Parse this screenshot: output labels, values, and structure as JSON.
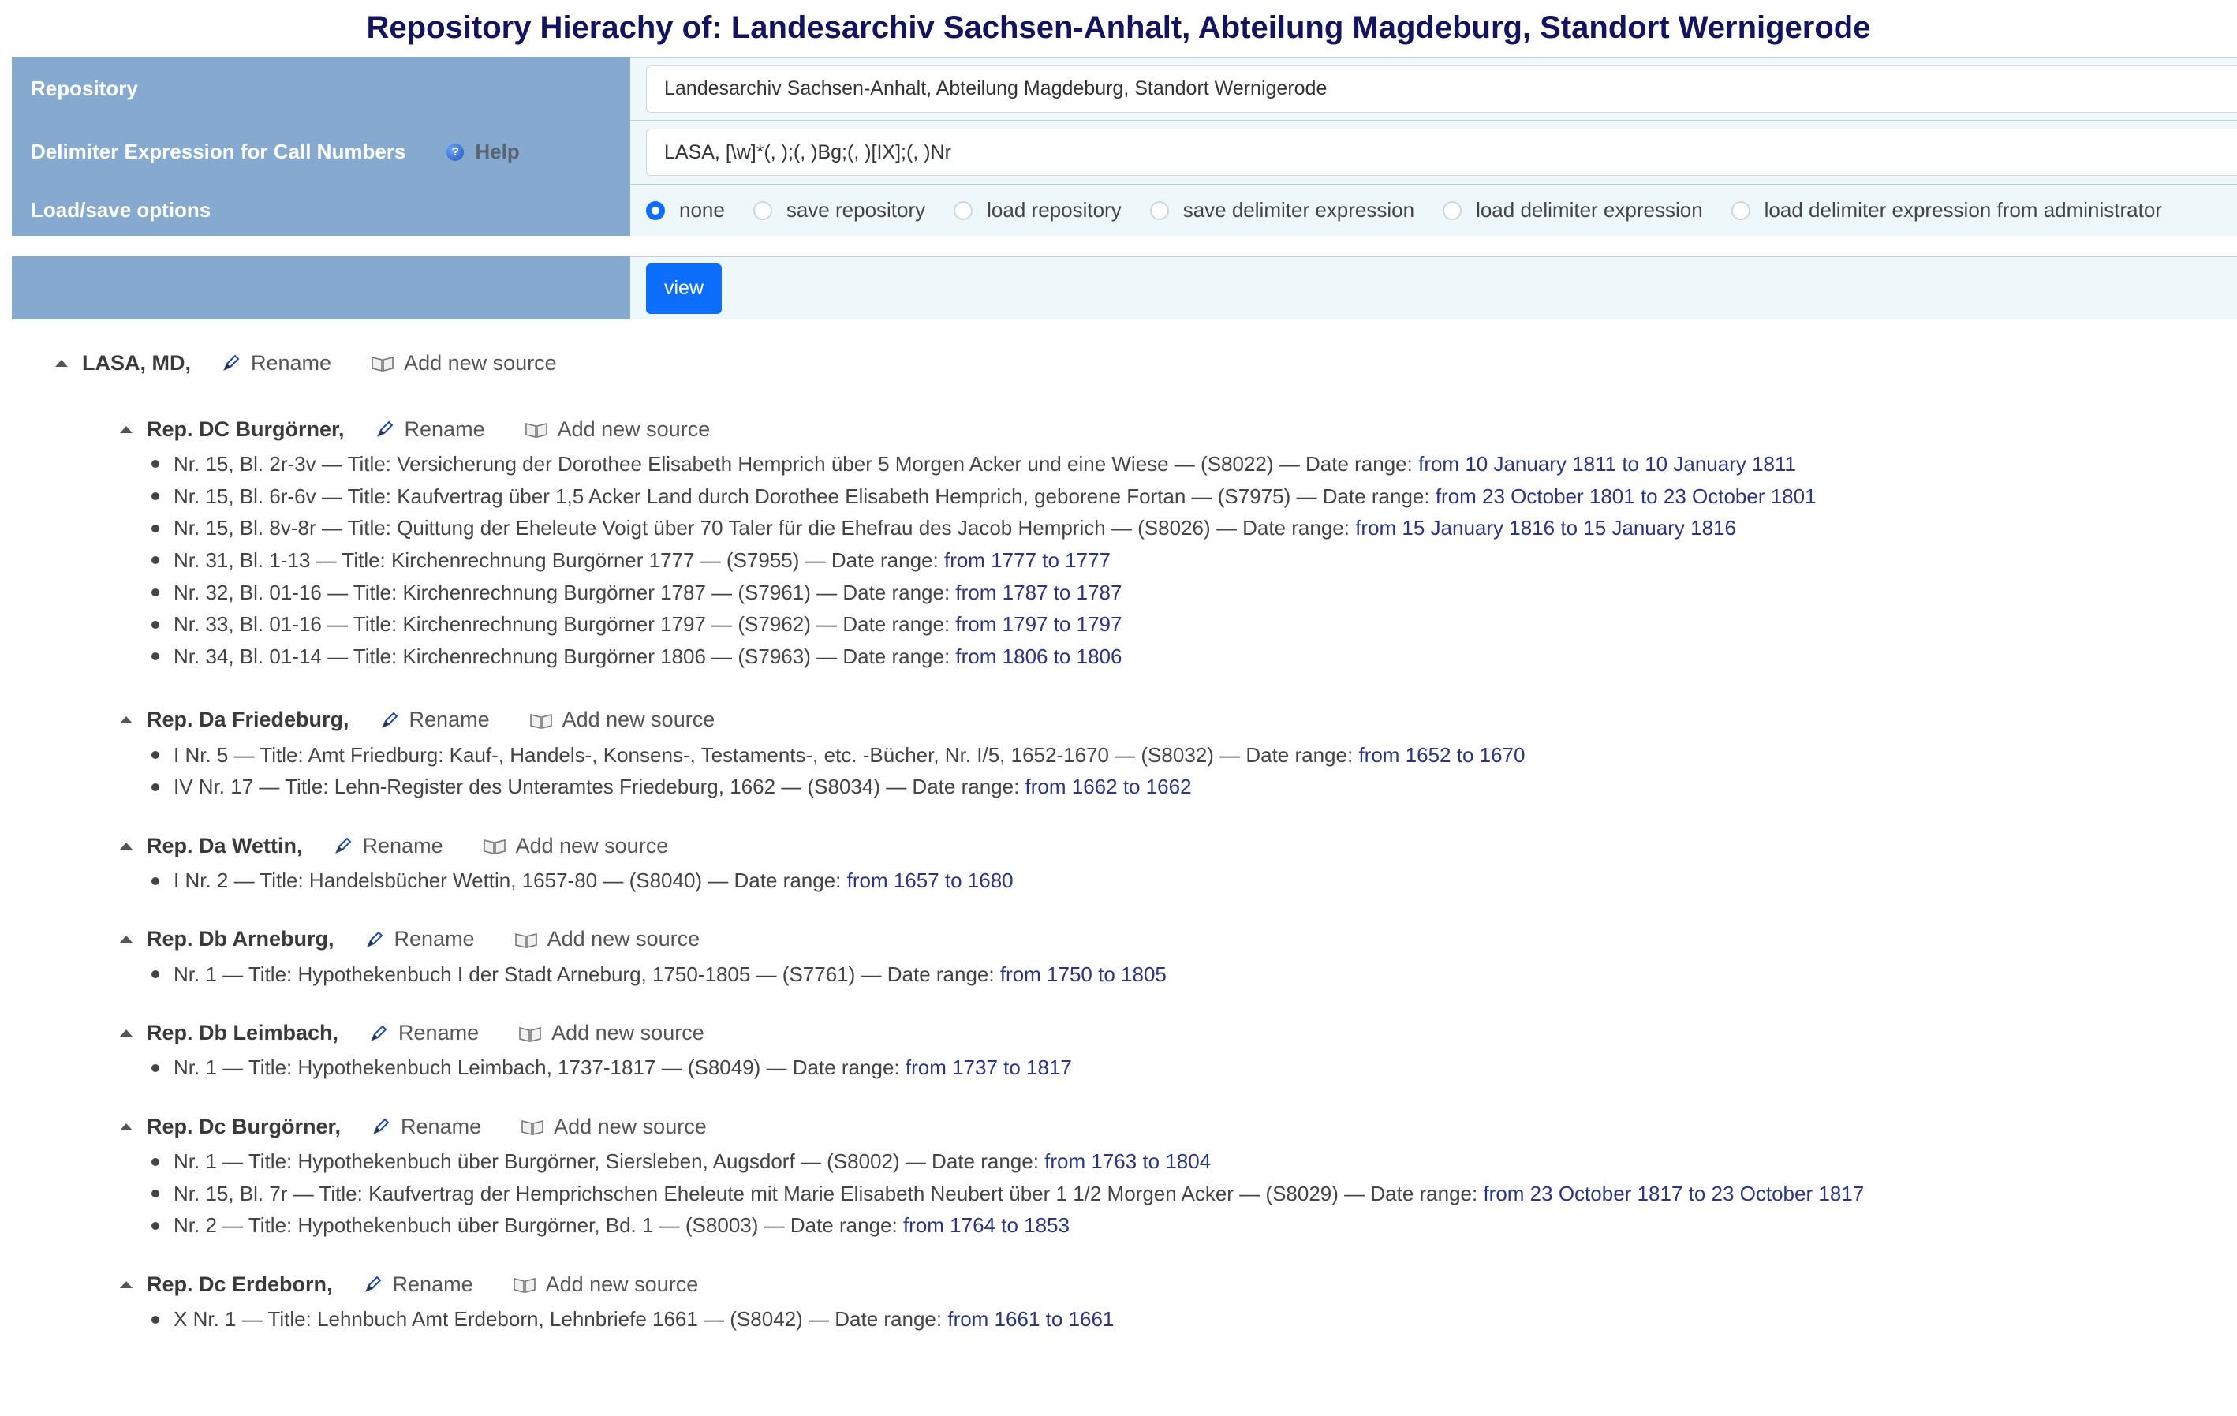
{
  "title": "Repository Hierachy of: Landesarchiv Sachsen-Anhalt, Abteilung Magdeburg, Standort Wernigerode",
  "form": {
    "repository_label": "Repository",
    "repository_value": "Landesarchiv Sachsen-Anhalt, Abteilung Magdeburg, Standort Wernigerode",
    "delimiter_label": "Delimiter Expression for Call Numbers",
    "help_label": "Help",
    "delimiter_value": "LASA, [\\w]*(, );(, )Bg;(, )[IX];(, )Nr",
    "options_label": "Load/save options",
    "options": [
      "none",
      "save repository",
      "load repository",
      "save delimiter expression",
      "load delimiter expression",
      "load delimiter expression from administrator"
    ],
    "selected_option": "none",
    "view_button": "view"
  },
  "actions": {
    "rename": "Rename",
    "add_source": "Add new source"
  },
  "root": {
    "name": "LASA, MD,"
  },
  "groups": [
    {
      "name": "Rep. DC Burgörner,",
      "items": [
        {
          "text": "Nr. 15, Bl. 2r-3v — Title: Versicherung der Dorothee Elisabeth Hemprich über 5 Morgen Acker und eine Wiese — (S8022) — Date range: ",
          "range": "from 10 January 1811 to 10 January 1811"
        },
        {
          "text": "Nr. 15, Bl. 6r-6v — Title: Kaufvertrag über 1,5 Acker Land durch Dorothee Elisabeth Hemprich, geborene Fortan — (S7975) — Date range: ",
          "range": "from 23 October 1801 to 23 October 1801"
        },
        {
          "text": "Nr. 15, Bl. 8v-8r — Title: Quittung der Eheleute Voigt über 70 Taler für die Ehefrau des Jacob Hemprich — (S8026) — Date range: ",
          "range": "from 15 January 1816 to 15 January 1816"
        },
        {
          "text": "Nr. 31, Bl. 1-13 — Title: Kirchenrechnung Burgörner 1777 — (S7955) — Date range: ",
          "range": "from 1777 to 1777"
        },
        {
          "text": "Nr. 32, Bl. 01-16 — Title: Kirchenrechnung Burgörner 1787 — (S7961) — Date range: ",
          "range": "from 1787 to 1787"
        },
        {
          "text": "Nr. 33, Bl. 01-16 — Title: Kirchenrechnung Burgörner 1797 — (S7962) — Date range: ",
          "range": "from 1797 to 1797"
        },
        {
          "text": "Nr. 34, Bl. 01-14 — Title: Kirchenrechnung Burgörner 1806 — (S7963) — Date range: ",
          "range": "from 1806 to 1806"
        }
      ]
    },
    {
      "name": "Rep. Da Friedeburg,",
      "items": [
        {
          "text": "I Nr. 5 — Title: Amt Friedburg: Kauf-, Handels-, Konsens-, Testaments-, etc. -Bücher, Nr. I/5, 1652-1670 — (S8032) — Date range: ",
          "range": "from 1652 to 1670"
        },
        {
          "text": "IV Nr. 17 — Title: Lehn-Register des Unteramtes Friedeburg, 1662 — (S8034) — Date range: ",
          "range": "from 1662 to 1662"
        }
      ]
    },
    {
      "name": "Rep. Da Wettin,",
      "items": [
        {
          "text": "I Nr. 2 — Title: Handelsbücher Wettin, 1657-80 — (S8040) — Date range: ",
          "range": "from 1657 to 1680"
        }
      ]
    },
    {
      "name": "Rep. Db Arneburg,",
      "items": [
        {
          "text": "Nr. 1 — Title: Hypothekenbuch I der Stadt Arneburg, 1750-1805 — (S7761) — Date range: ",
          "range": "from 1750 to 1805"
        }
      ]
    },
    {
      "name": "Rep. Db Leimbach,",
      "items": [
        {
          "text": "Nr. 1 — Title: Hypothekenbuch Leimbach, 1737-1817 — (S8049) — Date range: ",
          "range": "from 1737 to 1817"
        }
      ]
    },
    {
      "name": "Rep. Dc Burgörner,",
      "items": [
        {
          "text": "Nr. 1 — Title: Hypothekenbuch über Burgörner, Siersleben, Augsdorf — (S8002) — Date range: ",
          "range": "from 1763 to 1804"
        },
        {
          "text": "Nr. 15, Bl. 7r — Title: Kaufvertrag der Hemprichschen Eheleute mit Marie Elisabeth Neubert über 1 1/2 Morgen Acker — (S8029) — Date range: ",
          "range": "from 23 October 1817 to 23 October 1817"
        },
        {
          "text": "Nr. 2 — Title: Hypothekenbuch über Burgörner, Bd. 1 — (S8003) — Date range: ",
          "range": "from 1764 to 1853"
        }
      ]
    },
    {
      "name": "Rep. Dc Erdeborn,",
      "items": [
        {
          "text": "X Nr. 1 — Title: Lehnbuch Amt Erdeborn, Lehnbriefe 1661 — (S8042) — Date range: ",
          "range": "from 1661 to 1661"
        }
      ]
    }
  ]
}
